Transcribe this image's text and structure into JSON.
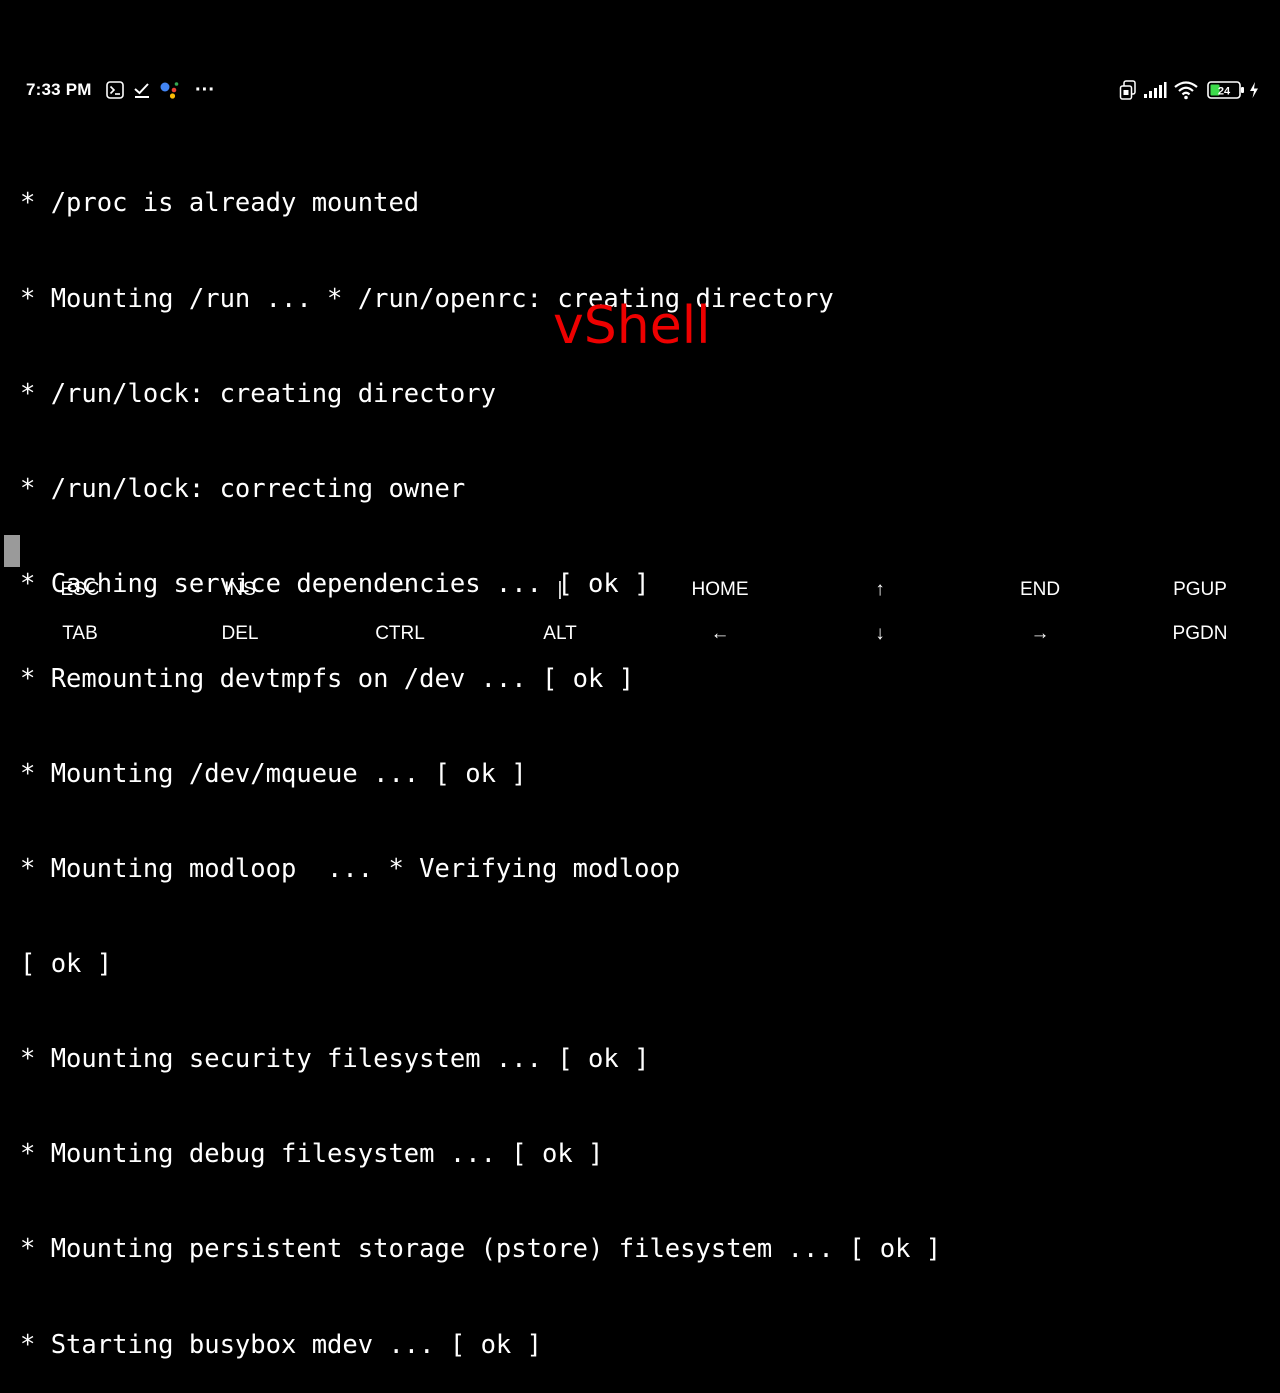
{
  "status_bar": {
    "time": "7:33 PM",
    "left_icons": [
      "terminal-icon",
      "check-icon",
      "assistant-icon",
      "more-icon"
    ],
    "right_icons": [
      "sim-icon",
      "signal-icon",
      "wifi-icon",
      "battery-icon",
      "charging-icon"
    ],
    "more_glyph": "···",
    "battery_level": "24",
    "battery_color": "#3ddc4b"
  },
  "terminal": {
    "lines": [
      "* /proc is already mounted",
      "* Mounting /run ... * /run/openrc: creating directory",
      "* /run/lock: creating directory",
      "* /run/lock: correcting owner",
      "* Caching service dependencies ... [ ok ]",
      "* Remounting devtmpfs on /dev ... [ ok ]",
      "* Mounting /dev/mqueue ... [ ok ]",
      "* Mounting modloop  ... * Verifying modloop",
      "[ ok ]",
      "* Mounting security filesystem ... [ ok ]",
      "* Mounting debug filesystem ... [ ok ]",
      "* Mounting persistent storage (pstore) filesystem ... [ ok ]",
      "* Starting busybox mdev ... [ ok ]"
    ]
  },
  "watermark": "vShell",
  "watermark_color": "#ee0000",
  "extra_keys": {
    "row1": [
      "ESC",
      "INS",
      "—",
      "|",
      "HOME",
      "↑",
      "END",
      "PGUP"
    ],
    "row2": [
      "TAB",
      "DEL",
      "CTRL",
      "ALT",
      "←",
      "↓",
      "→",
      "PGDN"
    ]
  }
}
